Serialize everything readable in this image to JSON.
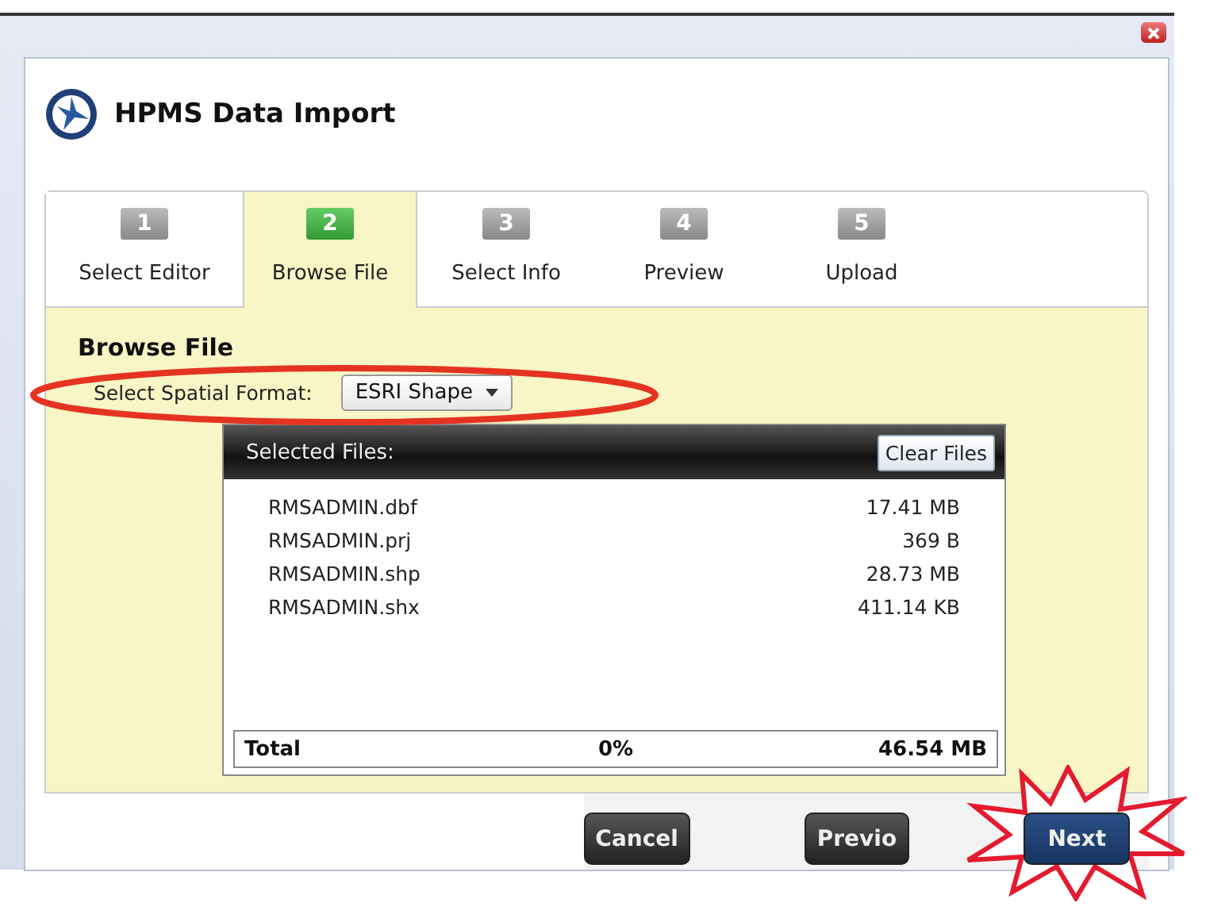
{
  "window": {
    "title": "HPMS Data Import"
  },
  "steps": [
    {
      "number": "1",
      "label": "Select Editor",
      "selected": false
    },
    {
      "number": "2",
      "label": "Browse File",
      "selected": true
    },
    {
      "number": "3",
      "label": "Select Info",
      "selected": false
    },
    {
      "number": "4",
      "label": "Preview",
      "selected": false
    },
    {
      "number": "5",
      "label": "Upload",
      "selected": false
    }
  ],
  "section_title": "Browse File",
  "format": {
    "label": "Select Spatial Format:",
    "value": "ESRI Shape"
  },
  "files": {
    "header": "Selected Files:",
    "clear_button": "Clear Files",
    "rows": [
      {
        "name": "RMSADMIN.dbf",
        "size": "17.41 MB"
      },
      {
        "name": "RMSADMIN.prj",
        "size": "369 B"
      },
      {
        "name": "RMSADMIN.shp",
        "size": "28.73 MB"
      },
      {
        "name": "RMSADMIN.shx",
        "size": "411.14 KB"
      }
    ],
    "total": {
      "label": "Total",
      "percent": "0%",
      "size": "46.54 MB"
    }
  },
  "buttons": [
    {
      "label": "Cancel",
      "kind": "dark"
    },
    {
      "label": "Previo",
      "kind": "dark"
    },
    {
      "label": "Next",
      "kind": "primary"
    }
  ]
}
